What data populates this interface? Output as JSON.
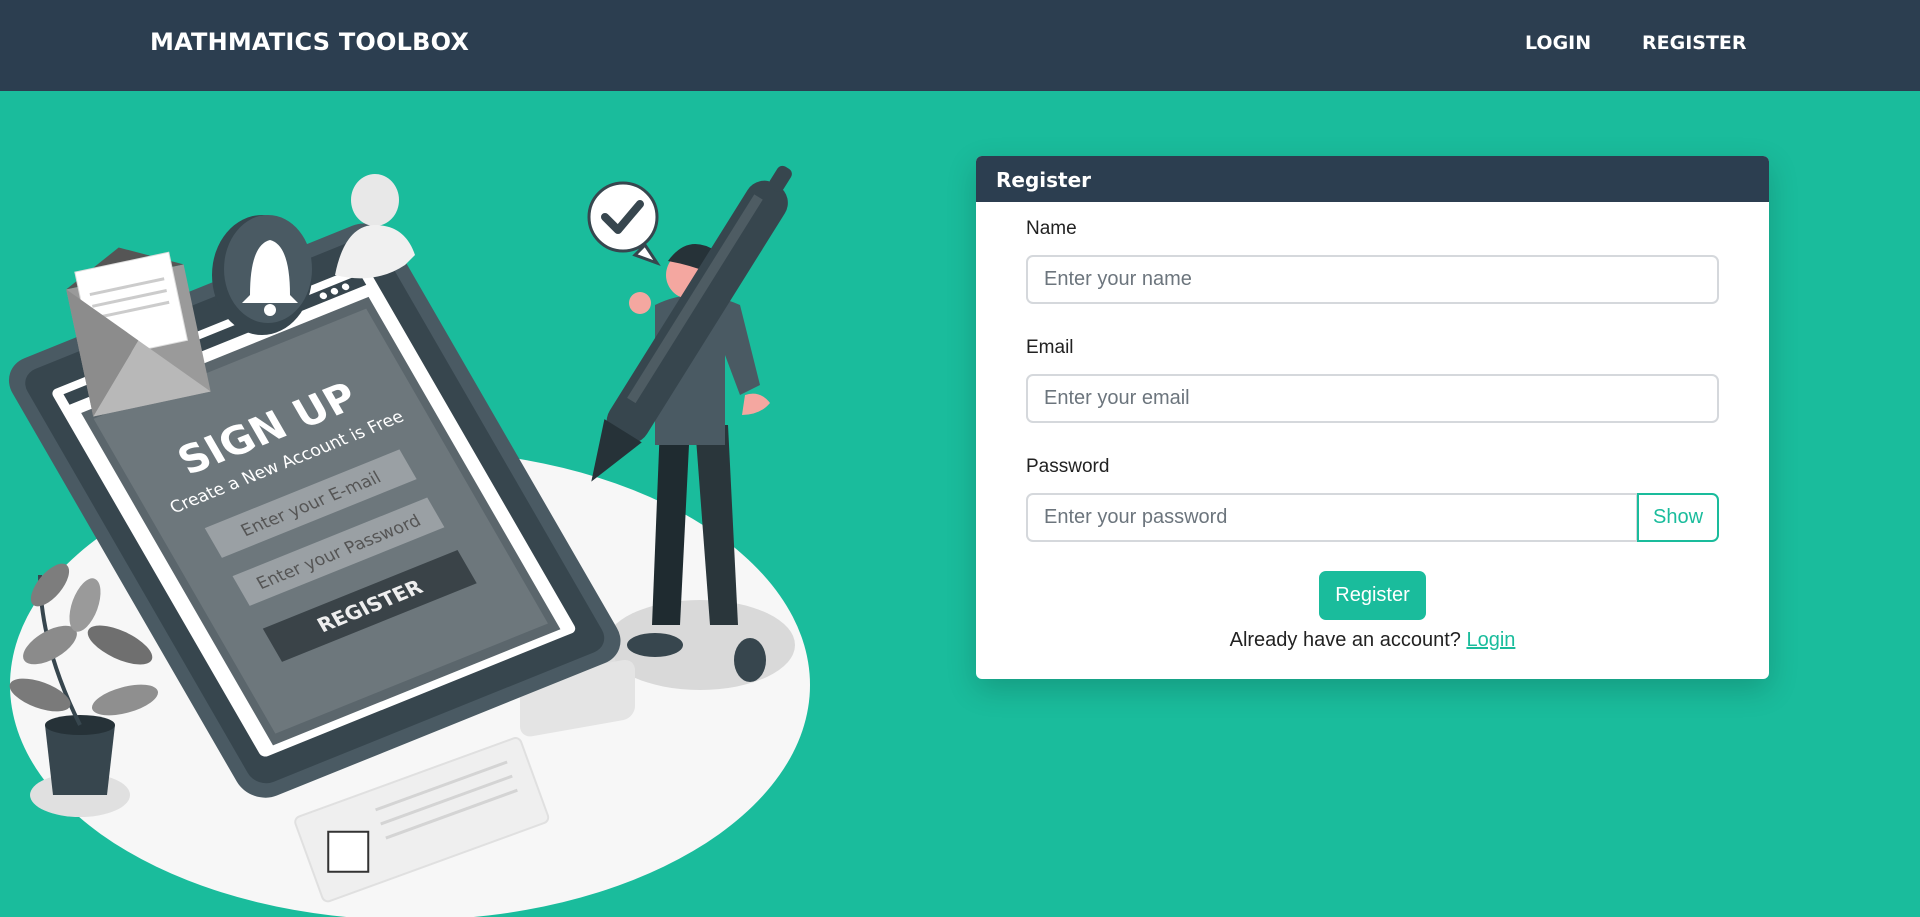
{
  "navbar": {
    "brand": "MATHMATICS TOOLBOX",
    "links": [
      "LOGIN",
      "REGISTER"
    ]
  },
  "illustration": {
    "screen_title": "SIGN UP",
    "screen_subtitle": "Create a New Account is Free",
    "email_placeholder": "Enter your E-mail",
    "password_placeholder": "Enter your Password",
    "button_text": "REGISTER"
  },
  "form": {
    "title": "Register",
    "name_label": "Name",
    "name_placeholder": "Enter your name",
    "email_label": "Email",
    "email_placeholder": "Enter your email",
    "password_label": "Password",
    "password_placeholder": "Enter your password",
    "show_label": "Show",
    "submit_label": "Register",
    "footer_text": "Already have an account?",
    "footer_link": "Login"
  },
  "colors": {
    "navbar": "#2c3e50",
    "background": "#1abc9c",
    "accent": "#1abc9c"
  }
}
